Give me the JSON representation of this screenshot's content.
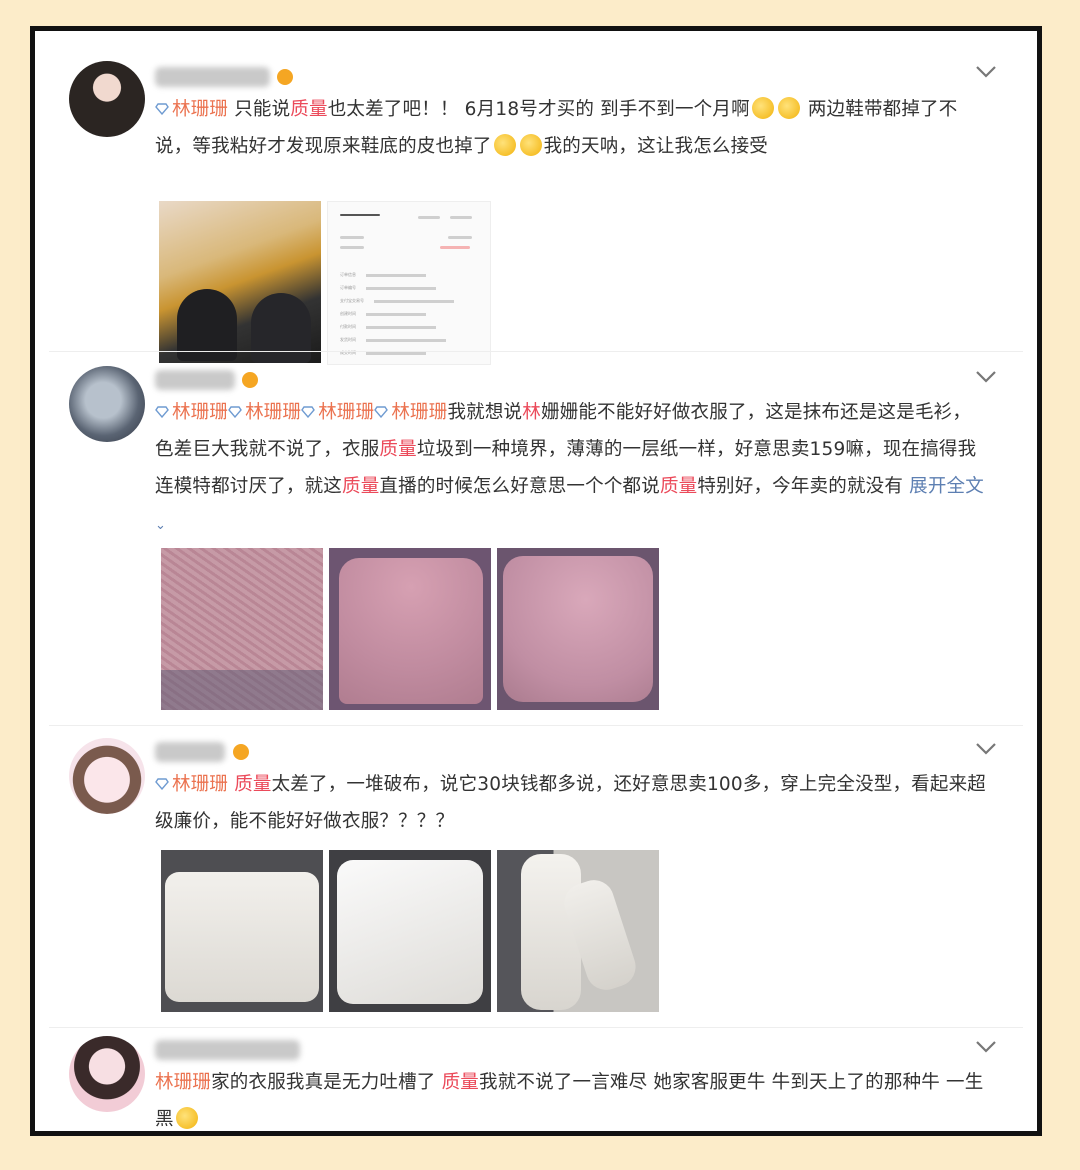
{
  "posts": [
    {
      "tag": "林珊珊",
      "segments": [
        {
          "t": " 只能说"
        },
        {
          "t": "质量",
          "hl": true
        },
        {
          "t": "也太差了吧！！ 6月18号才买的 到手不到一个月啊"
        },
        {
          "emoji": "cry"
        },
        {
          "emoji": "cry"
        },
        {
          "t": " 两边鞋带都掉了不说，等我粘好才发现原来鞋底的皮也掉了"
        },
        {
          "emoji": "cry"
        },
        {
          "emoji": "cry"
        },
        {
          "t": "我的天呐，这让我怎么接受"
        }
      ],
      "images": [
        "shoe-photo",
        "order-screenshot"
      ]
    },
    {
      "tags": [
        "林珊珊",
        "林珊珊",
        "林珊珊",
        "林珊珊"
      ],
      "segments": [
        {
          "t": "我就想说"
        },
        {
          "t": "林",
          "hl": true
        },
        {
          "t": "姗姗能不能好好做衣服了，这是抹布还是这是毛衫，色差巨大我就不说了，衣服"
        },
        {
          "t": "质量",
          "hl": true
        },
        {
          "t": "垃圾到一种境界，薄薄的一层纸一样，好意思卖159嘛，现在搞得我连模特都讨厌了，就这"
        },
        {
          "t": "质量",
          "hl": true
        },
        {
          "t": "直播的时候怎么好意思一个个都说"
        },
        {
          "t": "质量",
          "hl": true
        },
        {
          "t": "特别好，今年卖的就没有 "
        }
      ],
      "more": "展开全文",
      "images": [
        "pink-sweater-1",
        "pink-sweater-2",
        "pink-sweater-3"
      ]
    },
    {
      "tag": "林珊珊",
      "segments": [
        {
          "t": " "
        },
        {
          "t": "质量",
          "hl": true
        },
        {
          "t": "太差了，一堆破布，说它30块钱都多说，还好意思卖100多，穿上完全没型，看起来超级廉价，能不能好好做衣服？？？？"
        }
      ],
      "images": [
        "white-top-1",
        "white-top-2",
        "white-pants"
      ]
    },
    {
      "tag": "林珊珊",
      "segments": [
        {
          "t": "家的衣服我真是无力吐槽了 "
        },
        {
          "t": "质量",
          "hl": true
        },
        {
          "t": "我就不说了一言难尽 她家客服更牛 牛到天上了的那种牛 一生黑"
        },
        {
          "emoji": "smirk"
        }
      ],
      "images": []
    }
  ],
  "order_screenshot": {
    "lines": [
      "订单信息",
      "订单编号",
      "支付宝交易号",
      "创建时间",
      "付款时间",
      "发货时间",
      "成交时间"
    ]
  },
  "colors": {
    "background": "#fcecc9",
    "tag": "#eb7350",
    "highlight": "#eb4a5a",
    "link": "#5d7fb2"
  }
}
